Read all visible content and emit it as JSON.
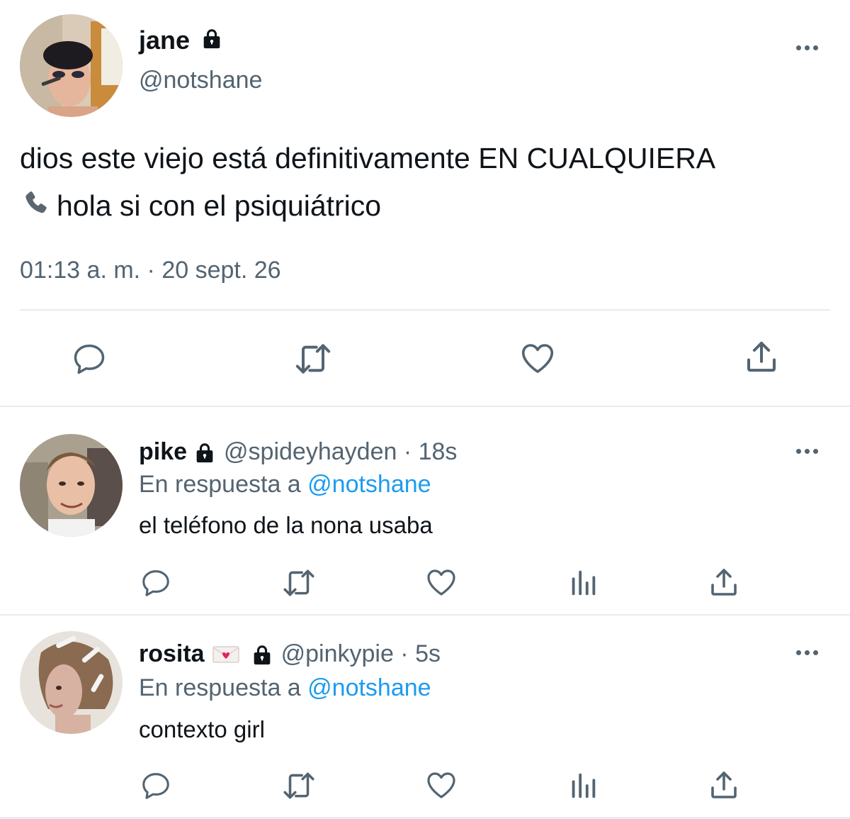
{
  "main_tweet": {
    "author": {
      "name": "jane",
      "handle": "@notshane",
      "protected": true
    },
    "text_line1": "dios este viejo está definitivamente EN CUALQUIERA",
    "text_line2": "hola si con el psiquiátrico",
    "text_line2_emoji": "telephone-receiver-icon",
    "timestamp": "01:13 a. m. · 20 sept. 26",
    "actions": [
      "reply-icon",
      "retweet-icon",
      "like-icon",
      "share-icon"
    ]
  },
  "replies": [
    {
      "author": {
        "name": "pike",
        "handle": "@spideyhayden",
        "protected": true
      },
      "time": " · 18s",
      "reply_prefix": "En respuesta a ",
      "reply_to": "@notshane",
      "text": "el teléfono de la nona usaba",
      "actions": [
        "reply-icon",
        "retweet-icon",
        "like-icon",
        "analytics-icon",
        "share-icon"
      ]
    },
    {
      "author": {
        "name": "rosita",
        "name_emoji": "love-letter-icon",
        "handle": "@pinkypie",
        "protected": true
      },
      "time": " · 5s",
      "reply_prefix": "En respuesta a ",
      "reply_to": "@notshane",
      "text": "contexto girl",
      "actions": [
        "reply-icon",
        "retweet-icon",
        "like-icon",
        "analytics-icon",
        "share-icon"
      ]
    }
  ],
  "colors": {
    "text": "#0f1419",
    "secondary": "#536471",
    "link": "#1d9bf0",
    "divider": "#e6ecf0",
    "icon": "#536471"
  }
}
